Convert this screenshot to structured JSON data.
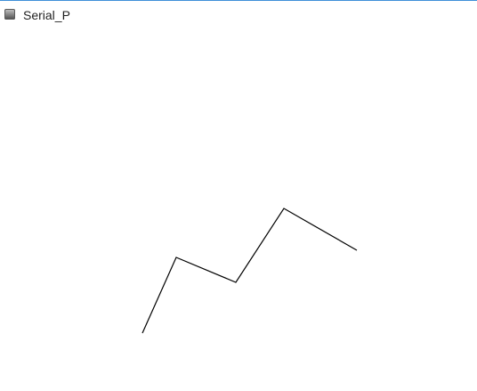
{
  "window": {
    "title": "Serial_P",
    "icon": "app-window-icon"
  },
  "canvas": {
    "line_color": "#000000"
  }
}
